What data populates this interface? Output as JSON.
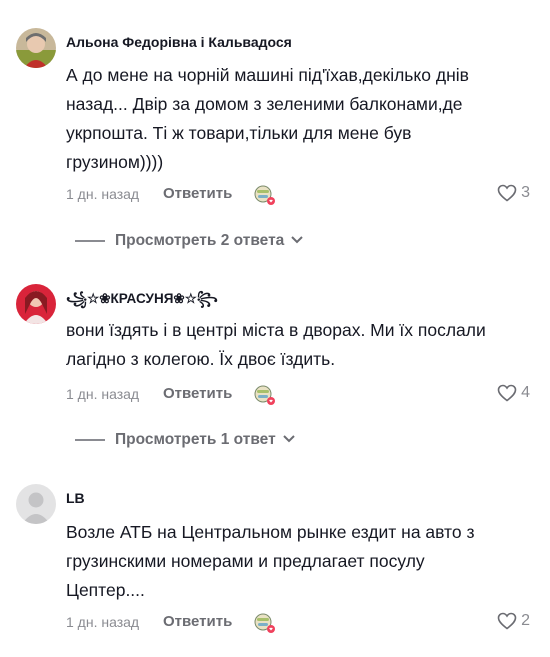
{
  "comments": [
    {
      "author": "Альона Федорівна і Кальвадося",
      "text": "А до мене на чорній машині під'їхав,декілько днів\nназад... Двір за домом з зеленими балконами,де\nукрпошта. Ті ж товари,тільки для мене був\nгрузином))))",
      "time": "1 дн. назад",
      "reply_label": "Ответить",
      "likes": "3",
      "replies_label": "Просмотреть 2 ответа",
      "avatar_color": "#9aa24a"
    },
    {
      "author": "꧁☆❀КРАСУНЯ❀☆꧂",
      "text": "вони їздять і в центрі міста в дворах. Ми їх послали\nлагідно з колегою. Їх двоє їздить.",
      "time": "1 дн. назад",
      "reply_label": "Ответить",
      "likes": "4",
      "replies_label": "Просмотреть 1 ответ",
      "avatar_color": "#d9243a"
    },
    {
      "author": "LB",
      "text": "Возле АТБ на Центральном рынке ездит на авто з\nгрузинскими номерами и предлагает посулу\nЦептер....",
      "time": "1 дн. назад",
      "reply_label": "Ответить",
      "likes": "2",
      "avatar_color": "#dcdcdc"
    }
  ],
  "icons": {
    "like": "heart-outline-icon",
    "sticker": "sticker-icon",
    "expand": "chevron-down-icon"
  }
}
